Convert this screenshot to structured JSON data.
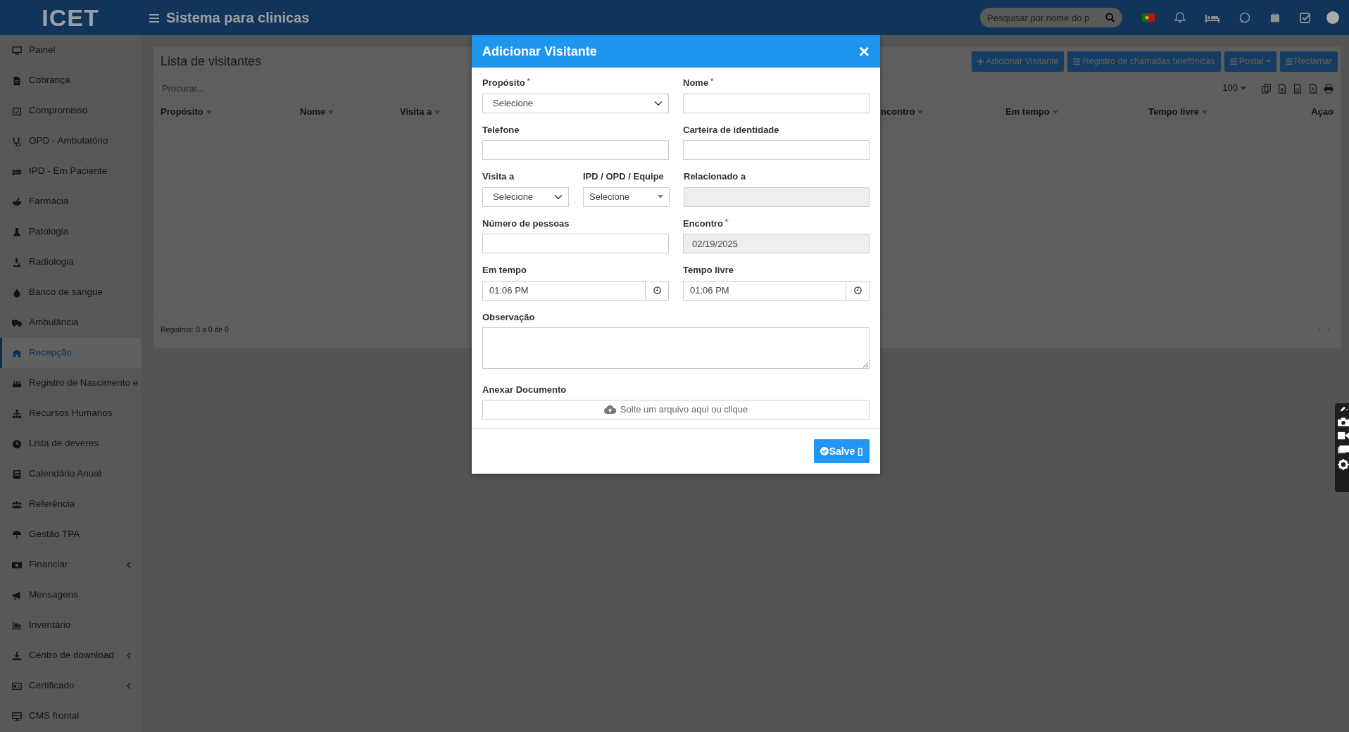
{
  "topbar": {
    "logo": "ICET",
    "title": "Sistema para clinicas",
    "search": {
      "placeholder": "Pesquisar por nome do p"
    }
  },
  "sidebar": {
    "items": [
      {
        "label": "Painel",
        "selected": false,
        "has_submenu": false
      },
      {
        "label": "Cobrança",
        "selected": false,
        "has_submenu": false
      },
      {
        "label": "Compromisso",
        "selected": false,
        "has_submenu": false
      },
      {
        "label": "OPD - Ambulatório",
        "selected": false,
        "has_submenu": false
      },
      {
        "label": "IPD - Em Paciente",
        "selected": false,
        "has_submenu": false
      },
      {
        "label": "Farmácia",
        "selected": false,
        "has_submenu": false
      },
      {
        "label": "Patologia",
        "selected": false,
        "has_submenu": false
      },
      {
        "label": "Radiologia",
        "selected": false,
        "has_submenu": false
      },
      {
        "label": "Banco de sangue",
        "selected": false,
        "has_submenu": false
      },
      {
        "label": "Ambulância",
        "selected": false,
        "has_submenu": false
      },
      {
        "label": "Recepção",
        "selected": true,
        "has_submenu": false
      },
      {
        "label": "Registro de Nascimento e",
        "selected": false,
        "has_submenu": false
      },
      {
        "label": "Recursos Humanos",
        "selected": false,
        "has_submenu": false
      },
      {
        "label": "Lista de deveres",
        "selected": false,
        "has_submenu": false
      },
      {
        "label": "Calendário Anual",
        "selected": false,
        "has_submenu": false
      },
      {
        "label": "Referência",
        "selected": false,
        "has_submenu": false
      },
      {
        "label": "Gestão TPA",
        "selected": false,
        "has_submenu": false
      },
      {
        "label": "Financiar",
        "selected": false,
        "has_submenu": true
      },
      {
        "label": "Mensagens",
        "selected": false,
        "has_submenu": false
      },
      {
        "label": "Inventário",
        "selected": false,
        "has_submenu": false
      },
      {
        "label": "Centro de download",
        "selected": false,
        "has_submenu": true
      },
      {
        "label": "Certificado",
        "selected": false,
        "has_submenu": true
      },
      {
        "label": "CMS frontal",
        "selected": false,
        "has_submenu": false
      }
    ]
  },
  "content": {
    "title": "Lista de visitantes",
    "actions": [
      {
        "label": "Adicionar Visitante",
        "kind": "plus"
      },
      {
        "label": "Registro de chamadas telefônicas",
        "kind": "list"
      },
      {
        "label": "Postal",
        "kind": "dropdown"
      },
      {
        "label": "Reclamar",
        "kind": "list"
      }
    ],
    "search": {
      "placeholder": "Procurar..."
    },
    "page_size": "100",
    "columns": [
      {
        "label": "Propósito",
        "sortable": true
      },
      {
        "label": "Nome",
        "sortable": true
      },
      {
        "label": "Visita a",
        "sortable": true
      },
      {
        "label": "ncontro",
        "sortable": true
      },
      {
        "label": "Em tempo",
        "sortable": true
      },
      {
        "label": "Tempo livre",
        "sortable": true
      },
      {
        "label": "Açao",
        "sortable": false
      }
    ],
    "footer": "Registros: 0 a 0 de 0",
    "pager": [
      "‹",
      "›"
    ]
  },
  "modal": {
    "title": "Adicionar Visitante",
    "close": "×",
    "rows": [
      [
        {
          "label": "Propósito",
          "required_mark": "*",
          "kind": "select",
          "value": "Selecione",
          "disabled": false
        },
        {
          "label": "Nome",
          "required_mark": "*",
          "kind": "text",
          "disabled": false
        }
      ],
      [
        {
          "label": "Telefone",
          "kind": "text",
          "disabled": false
        },
        {
          "label": "Carteira de identidade",
          "kind": "text",
          "disabled": false
        }
      ],
      [
        {
          "label": "Visita a",
          "kind": "select",
          "value": "Selecione",
          "disabled": false
        },
        {
          "label": "IPD / OPD / Equipe",
          "kind": "combo",
          "value": "Selecione",
          "disabled": false
        },
        {
          "label": "Relacionado a",
          "kind": "text",
          "disabled": true
        }
      ],
      [
        {
          "label": "Número de pessoas",
          "kind": "text",
          "disabled": false
        },
        {
          "label": "Encontro",
          "required_mark": "*",
          "kind": "text",
          "value": "02/19/2025",
          "disabled": true
        }
      ],
      [
        {
          "label": "Em tempo",
          "kind": "time",
          "value": "01:06 PM",
          "disabled": false
        },
        {
          "label": "Tempo livre",
          "kind": "time",
          "value": "01:06 PM",
          "disabled": false
        }
      ],
      [
        {
          "label": "Observação",
          "kind": "textarea",
          "disabled": false
        }
      ],
      [
        {
          "label": "Anexar Documento",
          "kind": "file",
          "value": "Solte um arquivo aqui ou clique",
          "disabled": false
        }
      ]
    ],
    "save": {
      "label": "Salve",
      "suffix": "▯"
    }
  }
}
